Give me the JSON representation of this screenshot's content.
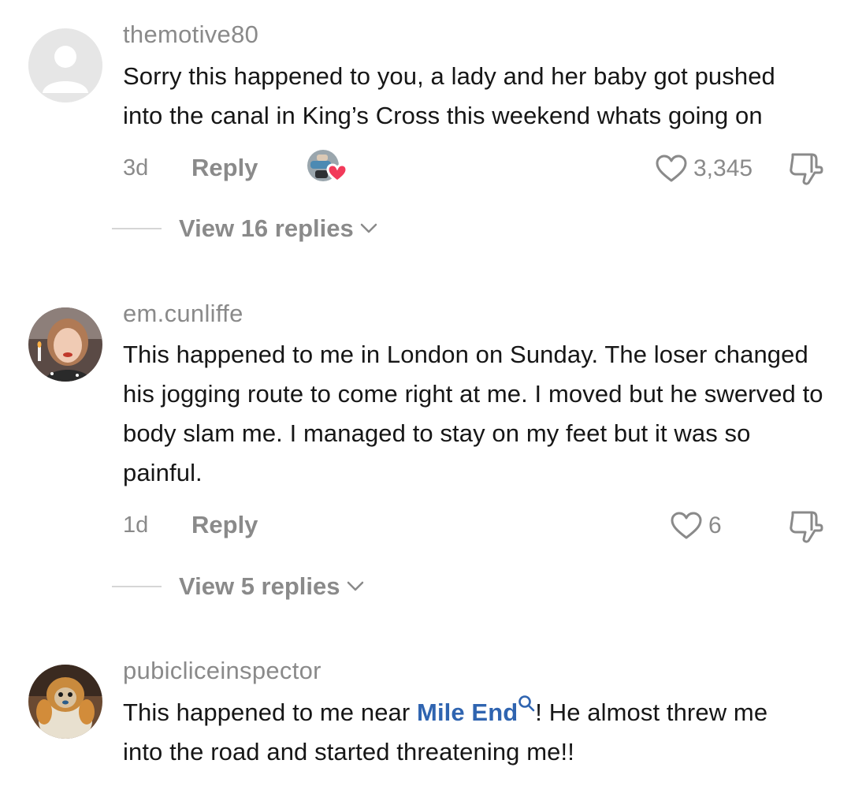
{
  "comments": [
    {
      "username": "themotive80",
      "text": "Sorry this happened to you, a lady and her baby got pushed into the canal in King’s Cross this weekend whats going on",
      "time": "3d",
      "reply_label": "Reply",
      "likes": "3,345",
      "view_replies": "View 16 replies",
      "avatar_icon": "default-user-avatar",
      "creator_liked": true
    },
    {
      "username": "em.cunliffe",
      "text": "This happened to me in London on Sunday. The loser changed his jogging route to come right at me. I moved but he swerved to body slam me. I managed to stay on my feet but it was so painful.",
      "time": "1d",
      "reply_label": "Reply",
      "likes": "6",
      "view_replies": "View 5 replies",
      "avatar_icon": "user-photo-avatar"
    },
    {
      "username": "pubicliceinspector",
      "text_before": "This happened to me near ",
      "mention": "Mile End",
      "text_after": "! He almost threw me into the road and started threatening me!!",
      "avatar_icon": "monkey-photo-avatar"
    }
  ],
  "colors": {
    "secondary_text": "#8a8a8a",
    "primary_text": "#161616",
    "link": "#2f64b0",
    "heart_badge": "#f23a5a"
  }
}
